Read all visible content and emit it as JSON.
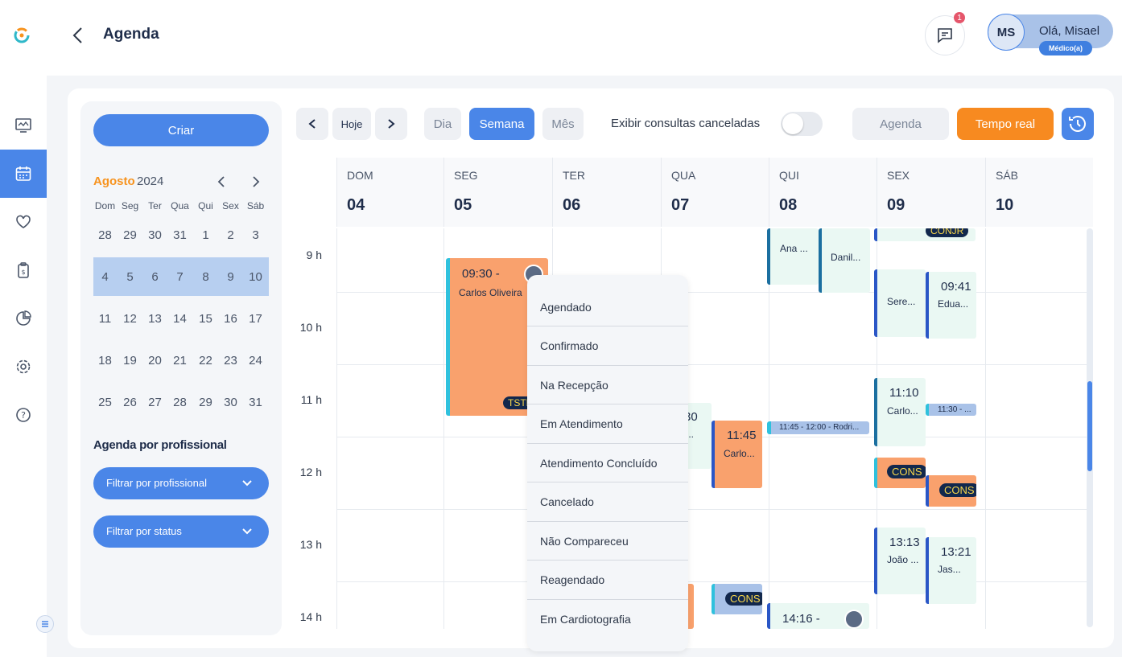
{
  "header": {
    "title": "Agenda",
    "notification_count": "1",
    "avatar_initials": "MS",
    "greeting": "Olá, Misael",
    "role_badge": "Médico(a)"
  },
  "left": {
    "create_label": "Criar",
    "month": "Agosto",
    "year": "2024",
    "dows": [
      "Dom",
      "Seg",
      "Ter",
      "Qua",
      "Qui",
      "Sex",
      "Sáb"
    ],
    "weeks": [
      [
        "28",
        "29",
        "30",
        "31",
        "1",
        "2",
        "3"
      ],
      [
        "4",
        "5",
        "6",
        "7",
        "8",
        "9",
        "10"
      ],
      [
        "11",
        "12",
        "13",
        "14",
        "15",
        "16",
        "17"
      ],
      [
        "18",
        "19",
        "20",
        "21",
        "22",
        "23",
        "24"
      ],
      [
        "25",
        "26",
        "27",
        "28",
        "29",
        "30",
        "31"
      ]
    ],
    "section_title": "Agenda por profissional",
    "filter_professional": "Filtrar por profissional",
    "filter_status": "Filtrar por status"
  },
  "toolbar": {
    "today": "Hoje",
    "day": "Dia",
    "week": "Semana",
    "month": "Mês",
    "show_cancelled": "Exibir consultas canceladas",
    "agenda": "Agenda",
    "realtime": "Tempo real"
  },
  "days": [
    {
      "dow": "DOM",
      "num": "04"
    },
    {
      "dow": "SEG",
      "num": "05"
    },
    {
      "dow": "TER",
      "num": "06"
    },
    {
      "dow": "QUA",
      "num": "07"
    },
    {
      "dow": "QUI",
      "num": "08"
    },
    {
      "dow": "SEX",
      "num": "09"
    },
    {
      "dow": "SÁB",
      "num": "10"
    }
  ],
  "hours": [
    "9 h",
    "10 h",
    "11 h",
    "12 h",
    "13 h",
    "14 h"
  ],
  "events": {
    "seg_time": "09:30 -",
    "seg_name": "Carlos Oliveira",
    "seg_pill": "TSTF",
    "qua_a_time": "30",
    "qua_a_name": "te...",
    "qua_b_time": "11:45",
    "qua_b_name": "Carlo...",
    "qua_c_pill": "CONS",
    "qui_a_name": "Ana ...",
    "qui_b_name": "Danil...",
    "qui_c_text": "11:45 - 12:00 - Rodri...",
    "qui_d_time": "14:16 -",
    "sex_a_pill": "CONJR",
    "sex_b_name": "Sere...",
    "sex_c_time": "09:41",
    "sex_c_name": "Edua...",
    "sex_d_time": "11:10",
    "sex_d_name": "Carlo...",
    "sex_e_text": "11:30 - ...",
    "sex_f_pill": "CONS",
    "sex_g_pill": "CONS",
    "sex_h_time": "13:13",
    "sex_h_name": "João ...",
    "sex_i_time": "13:21",
    "sex_i_name": "Jas..."
  },
  "status_menu": [
    "Agendado",
    "Confirmado",
    "Na Recepção",
    "Em Atendimento",
    "Atendimento Concluído",
    "Cancelado",
    "Não Compareceu",
    "Reagendado",
    "Em Cardiotografia"
  ]
}
